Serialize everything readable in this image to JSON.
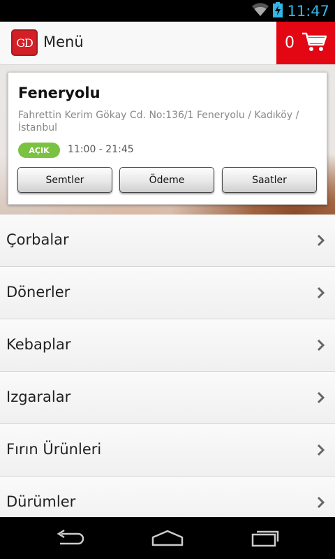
{
  "status_bar": {
    "time": "11:47",
    "wifi_icon": "wifi-icon",
    "battery_icon": "battery-charging-icon"
  },
  "header": {
    "logo_text": "GD",
    "title": "Menü",
    "cart_count": "0",
    "cart_icon": "cart-icon",
    "accent": "#e30613"
  },
  "branch": {
    "name": "Feneryolu",
    "address": "Fahrettin Kerim Gökay Cd. No:136/1 Feneryolu / Kadıköy / İstanbul",
    "status": "AÇIK",
    "status_color": "#7cc242",
    "hours": "11:00 - 21:45",
    "buttons": [
      "Semtler",
      "Ödeme",
      "Saatler"
    ]
  },
  "menu": {
    "items": [
      "Çorbalar",
      "Dönerler",
      "Kebaplar",
      "Izgaralar",
      "Fırın Ürünleri",
      "Dürümler"
    ]
  },
  "nav": {
    "back_icon": "back-icon",
    "home_icon": "home-icon",
    "recents_icon": "recents-icon"
  }
}
